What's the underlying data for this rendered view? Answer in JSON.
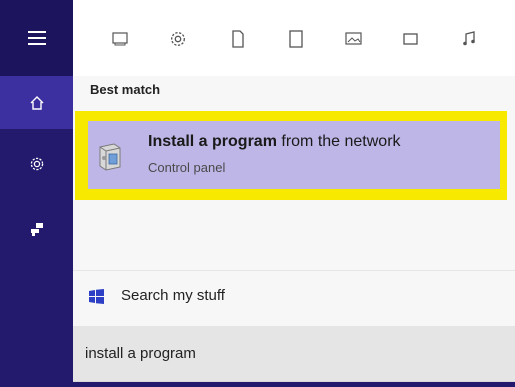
{
  "rail": {
    "menu_icon": "hamburger-menu-icon",
    "home_icon": "home-icon",
    "settings_icon": "gear-icon",
    "feedback_icon": "feedback-icon"
  },
  "filters": [
    {
      "icon": "apps-icon",
      "glyph": "▭"
    },
    {
      "icon": "settings-icon",
      "glyph": "⚙"
    },
    {
      "icon": "document-icon",
      "glyph": "🗋"
    },
    {
      "icon": "folder-icon",
      "glyph": "▯"
    },
    {
      "icon": "photos-icon",
      "glyph": "🖾"
    },
    {
      "icon": "videos-icon",
      "glyph": "▭"
    },
    {
      "icon": "music-icon",
      "glyph": "♫"
    }
  ],
  "results": {
    "heading": "Best match",
    "best_match": {
      "title_bold": "Install a program",
      "title_rest": " from the network",
      "subtitle": "Control panel"
    }
  },
  "search_my_stuff": {
    "label": "Search my stuff"
  },
  "search_box": {
    "query": "install a program"
  },
  "colors": {
    "rail": "#231a6e",
    "rail_active": "#3c30a0",
    "highlight": "#f7ea00",
    "selection": "#bdb6e6"
  }
}
